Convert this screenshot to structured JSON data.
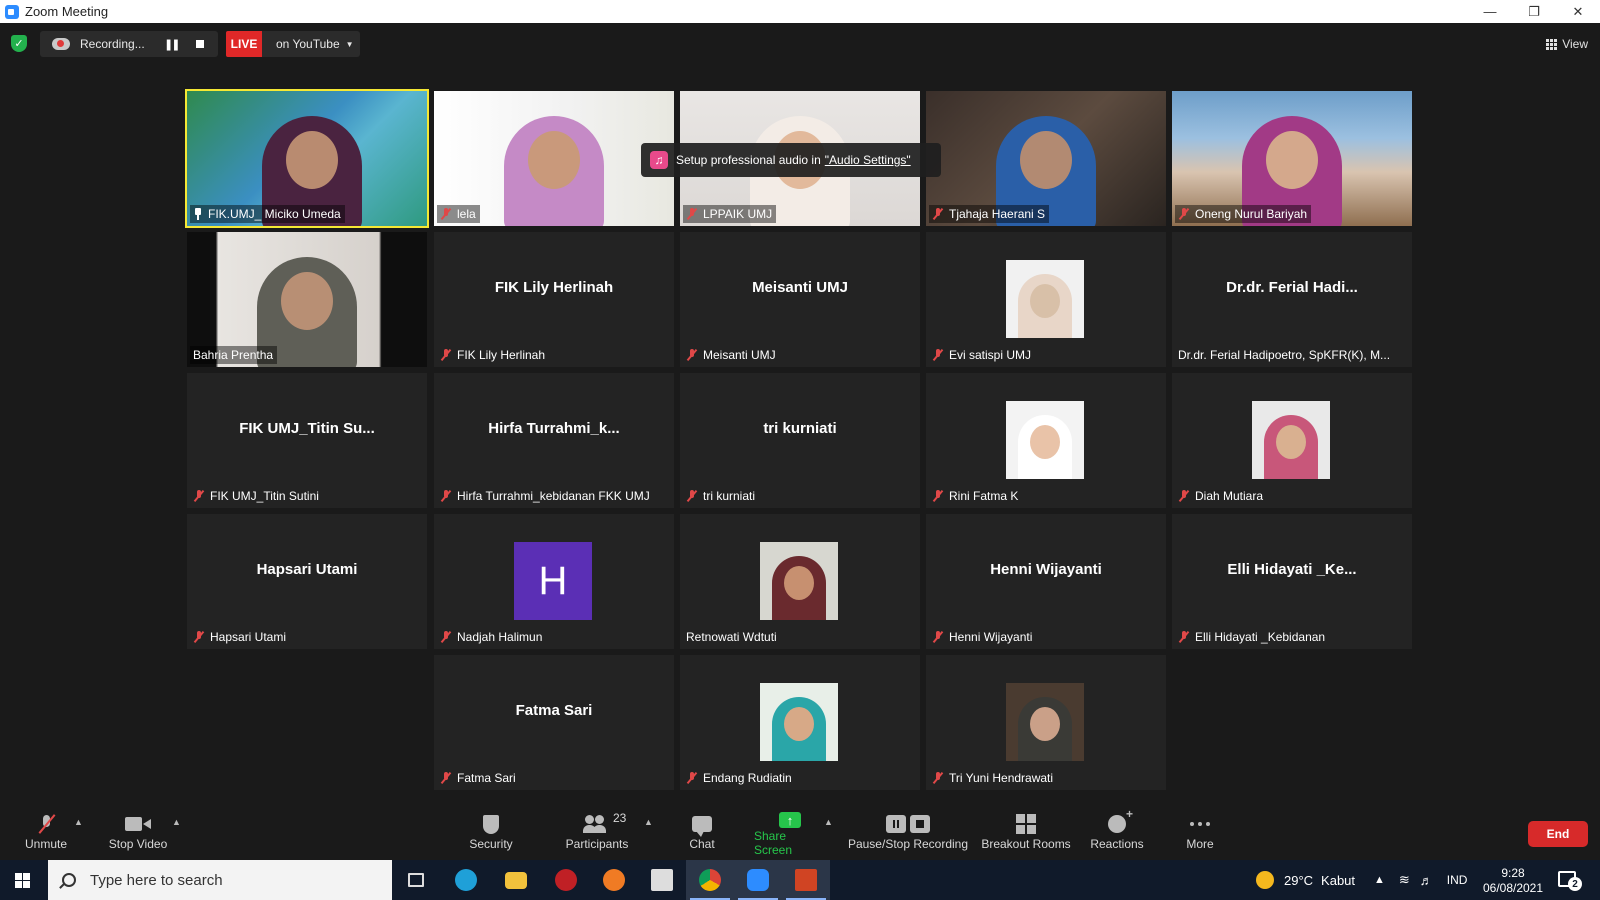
{
  "window": {
    "title": "Zoom Meeting"
  },
  "topbar": {
    "recording_text": "Recording...",
    "live_label": "LIVE",
    "stream_target": "on YouTube",
    "view_label": "View"
  },
  "toast": {
    "text": "Setup professional audio in",
    "link": "\"Audio Settings\""
  },
  "participants": [
    {
      "label": "FIK.UMJ_ Miciko Umeda",
      "display": "",
      "muted": false,
      "pinned": true,
      "active": true,
      "kind": "video-slide"
    },
    {
      "label": "lela",
      "display": "",
      "muted": true,
      "kind": "video"
    },
    {
      "label": "LPPAIK UMJ",
      "display": "",
      "muted": true,
      "kind": "video"
    },
    {
      "label": "Tjahaja Haerani S",
      "display": "",
      "muted": true,
      "kind": "video"
    },
    {
      "label": "Oneng Nurul Bariyah",
      "display": "",
      "muted": true,
      "kind": "video"
    },
    {
      "label": "Bahria Prentha",
      "display": "",
      "muted": false,
      "kind": "video"
    },
    {
      "label": "FIK Lily Herlinah",
      "display": "FIK Lily Herlinah",
      "muted": true,
      "kind": "name"
    },
    {
      "label": "Meisanti UMJ",
      "display": "Meisanti UMJ",
      "muted": true,
      "kind": "name"
    },
    {
      "label": "Evi satispi UMJ",
      "display": "",
      "muted": true,
      "kind": "photo"
    },
    {
      "label": "Dr.dr. Ferial Hadipoetro, SpKFR(K), M...",
      "display": "Dr.dr. Ferial Hadi...",
      "muted": false,
      "kind": "name"
    },
    {
      "label": "FIK UMJ_Titin Sutini",
      "display": "FIK UMJ_Titin Su...",
      "muted": true,
      "kind": "name"
    },
    {
      "label": "Hirfa Turrahmi_kebidanan FKK UMJ",
      "display": "Hirfa Turrahmi_k...",
      "muted": true,
      "kind": "name"
    },
    {
      "label": "tri kurniati",
      "display": "tri kurniati",
      "muted": true,
      "kind": "name"
    },
    {
      "label": "Rini Fatma K",
      "display": "",
      "muted": true,
      "kind": "photo"
    },
    {
      "label": "Diah Mutiara",
      "display": "",
      "muted": true,
      "kind": "photo"
    },
    {
      "label": "Hapsari Utami",
      "display": "Hapsari Utami",
      "muted": true,
      "kind": "name"
    },
    {
      "label": "Nadjah Halimun",
      "display": "H",
      "muted": true,
      "kind": "letter"
    },
    {
      "label": "Retnowati Wdtuti",
      "display": "",
      "muted": false,
      "kind": "photo"
    },
    {
      "label": "Henni Wijayanti",
      "display": "Henni Wijayanti",
      "muted": true,
      "kind": "name"
    },
    {
      "label": "Elli Hidayati _Kebidanan",
      "display": "Elli Hidayati _Ke...",
      "muted": true,
      "kind": "name"
    },
    {
      "label": "Fatma Sari",
      "display": "Fatma Sari",
      "muted": true,
      "kind": "name"
    },
    {
      "label": "Endang Rudiatin",
      "display": "",
      "muted": true,
      "kind": "photo"
    },
    {
      "label": "Tri Yuni Hendrawati",
      "display": "",
      "muted": true,
      "kind": "photo"
    }
  ],
  "toolbar": {
    "unmute": "Unmute",
    "stop_video": "Stop Video",
    "security": "Security",
    "participants": "Participants",
    "participants_count": "23",
    "chat": "Chat",
    "share_screen": "Share Screen",
    "pause_stop_recording": "Pause/Stop Recording",
    "breakout_rooms": "Breakout Rooms",
    "reactions": "Reactions",
    "more": "More",
    "end": "End"
  },
  "taskbar": {
    "search_placeholder": "Type here to search",
    "weather_temp": "29°C",
    "weather_desc": "Kabut",
    "language": "IND",
    "time": "9:28",
    "date": "06/08/2021",
    "notifications": "2"
  },
  "colors": {
    "accent_active_speaker": "#f5e834",
    "live_red": "#e02828",
    "share_green": "#26c64b",
    "end_red": "#d72a2a",
    "avatar_purple": "#5b2fb5"
  }
}
